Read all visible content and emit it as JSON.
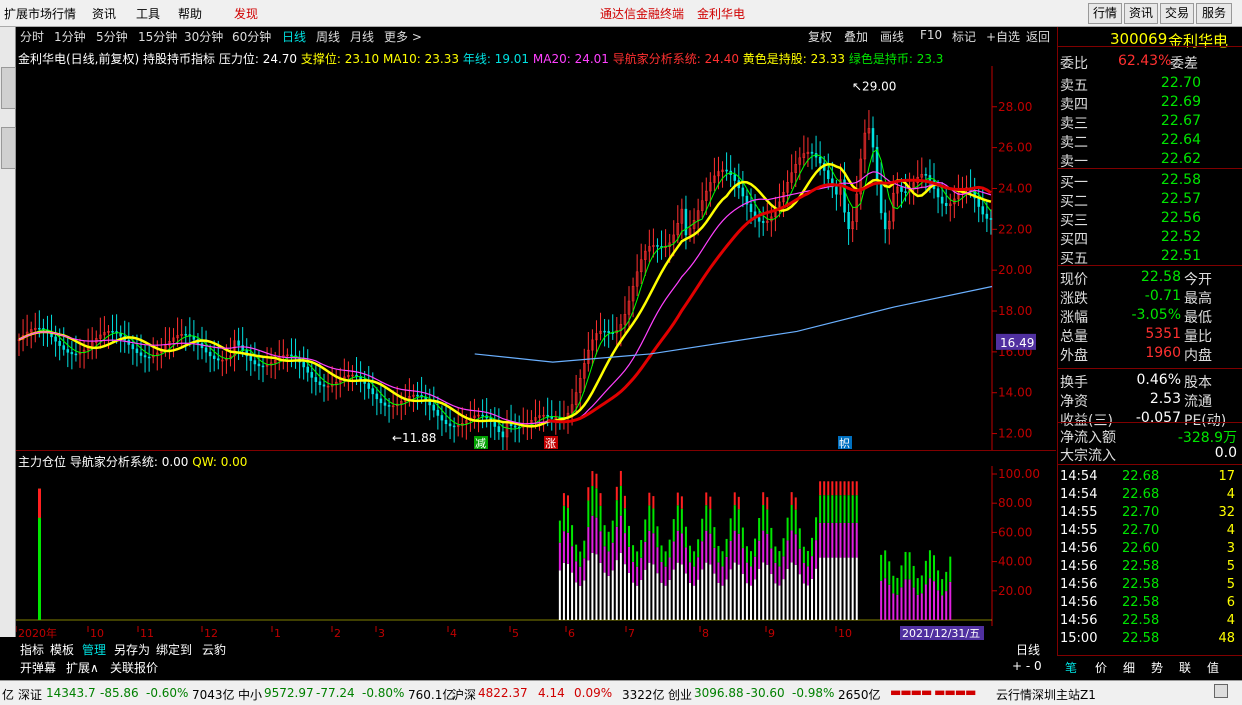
{
  "menu": {
    "items": [
      "扩展市场行情",
      "资讯",
      "工具",
      "帮助"
    ],
    "discover": "发现",
    "center_title": "通达信金融终端",
    "center_stock": "金利华电",
    "right_buttons": [
      "行情",
      "资讯",
      "交易",
      "服务"
    ]
  },
  "toolbar": {
    "periods": [
      "分时",
      "1分钟",
      "5分钟",
      "15分钟",
      "30分钟",
      "60分钟",
      "日线",
      "周线",
      "月线",
      "更多 >"
    ],
    "actions": [
      "复权",
      "叠加",
      "画线",
      "F10",
      "标记",
      "+自选",
      "返回"
    ]
  },
  "info1": {
    "name": "金利华电(日线,前复权)",
    "indicator": "持股持币指标",
    "pressure": "压力位: 24.70",
    "support": "支撑位: 23.10",
    "ma10": "MA10: 23.33",
    "year": "年线: 19.01",
    "ma20": "MA20: 24.01",
    "nav": "导航家分析系统: 24.40",
    "yellow": "黄色是持股: 23.33",
    "green": "绿色是持币: 23.3"
  },
  "main_chart": {
    "high_label": "29.00",
    "low_label": "11.88",
    "price_axis": [
      "28.00",
      "26.00",
      "24.00",
      "22.00",
      "20.00",
      "18.00",
      "16.00",
      "14.00",
      "12.00"
    ],
    "cursor_price": "16.49",
    "signals": [
      "减",
      "涨",
      "帜"
    ]
  },
  "info2": {
    "name": "主力仓位",
    "nav": "导航家分析系统: 0.00",
    "qw": "QW: 0.00"
  },
  "sub_chart": {
    "axis": [
      "100.00",
      "80.00",
      "60.00",
      "40.00",
      "20.00"
    ]
  },
  "dates": {
    "labels": [
      "2020年",
      "10",
      "11",
      "12",
      "1",
      "2",
      "3",
      "4",
      "5",
      "6",
      "7",
      "8",
      "9",
      "10"
    ],
    "cursor_date": "2021/12/31/五",
    "period": "日线"
  },
  "bottom_tabs": {
    "row1": [
      "指标",
      "模板",
      "管理",
      "另存为",
      "绑定到",
      "云豹"
    ],
    "row2": [
      "开弹幕",
      "扩展∧",
      "关联报价"
    ]
  },
  "quote": {
    "code": "300069",
    "name": "金利华电",
    "weibi_label": "委比",
    "weibi": "62.43%",
    "weicha_label": "委差",
    "asks": [
      {
        "label": "卖五",
        "price": "22.70"
      },
      {
        "label": "卖四",
        "price": "22.69"
      },
      {
        "label": "卖三",
        "price": "22.67"
      },
      {
        "label": "卖二",
        "price": "22.64"
      },
      {
        "label": "卖一",
        "price": "22.62"
      }
    ],
    "bids": [
      {
        "label": "买一",
        "price": "22.58"
      },
      {
        "label": "买二",
        "price": "22.57"
      },
      {
        "label": "买三",
        "price": "22.56"
      },
      {
        "label": "买四",
        "price": "22.52"
      },
      {
        "label": "买五",
        "price": "22.51"
      }
    ],
    "stats": [
      {
        "l": "现价",
        "v": "22.58",
        "r": "今开"
      },
      {
        "l": "涨跌",
        "v": "-0.71",
        "r": "最高"
      },
      {
        "l": "涨幅",
        "v": "-3.05%",
        "r": "最低"
      },
      {
        "l": "总量",
        "v": "5351",
        "r": "量比"
      },
      {
        "l": "外盘",
        "v": "1960",
        "r": "内盘"
      }
    ],
    "stats2": [
      {
        "l": "换手",
        "v": "0.46%",
        "r": "股本"
      },
      {
        "l": "净资",
        "v": "2.53",
        "r": "流通"
      },
      {
        "l": "收益(三)",
        "v": "-0.057",
        "r": "PE(动)"
      }
    ],
    "flow": [
      {
        "l": "净流入额",
        "v": "-328.9万"
      },
      {
        "l": "大宗流入",
        "v": "0.0"
      }
    ],
    "ticks": [
      {
        "t": "14:54",
        "p": "22.68",
        "v": "17"
      },
      {
        "t": "14:54",
        "p": "22.68",
        "v": "4"
      },
      {
        "t": "14:55",
        "p": "22.70",
        "v": "32"
      },
      {
        "t": "14:55",
        "p": "22.70",
        "v": "4"
      },
      {
        "t": "14:56",
        "p": "22.60",
        "v": "3"
      },
      {
        "t": "14:56",
        "p": "22.58",
        "v": "5"
      },
      {
        "t": "14:56",
        "p": "22.58",
        "v": "5"
      },
      {
        "t": "14:56",
        "p": "22.58",
        "v": "6"
      },
      {
        "t": "14:56",
        "p": "22.58",
        "v": "4"
      },
      {
        "t": "15:00",
        "p": "22.58",
        "v": "48"
      }
    ],
    "bottom_tabs": [
      "笔",
      "价",
      "细",
      "势",
      "联",
      "值"
    ]
  },
  "status": {
    "szzs_label": "深证",
    "szzs": "14343.7",
    "szzs_chg": "-85.86",
    "szzs_pct": "-0.60%",
    "szzs_amt": "7043亿",
    "zx_label": "中小",
    "zx": "9572.97",
    "zx_chg": "-77.24",
    "zx_pct": "-0.80%",
    "zx_amt": "760.1亿",
    "hs_label": "沪深",
    "hs": "4822.37",
    "hs_chg": "4.14",
    "hs_pct": "0.09%",
    "hs_amt": "3322亿",
    "cy_label": "创业",
    "cy": "3096.88",
    "cy_chg": "-30.60",
    "cy_pct": "-0.98%",
    "cy_amt": "2650亿",
    "server": "云行情深圳主站Z1",
    "left": "亿"
  },
  "colors": {
    "up": "#ff3030",
    "down": "#00e600",
    "ma_yellow": "#ffff00",
    "ma_red": "#e00000",
    "year_line": "#6ab0ff",
    "ma20": "#ff40ff"
  }
}
